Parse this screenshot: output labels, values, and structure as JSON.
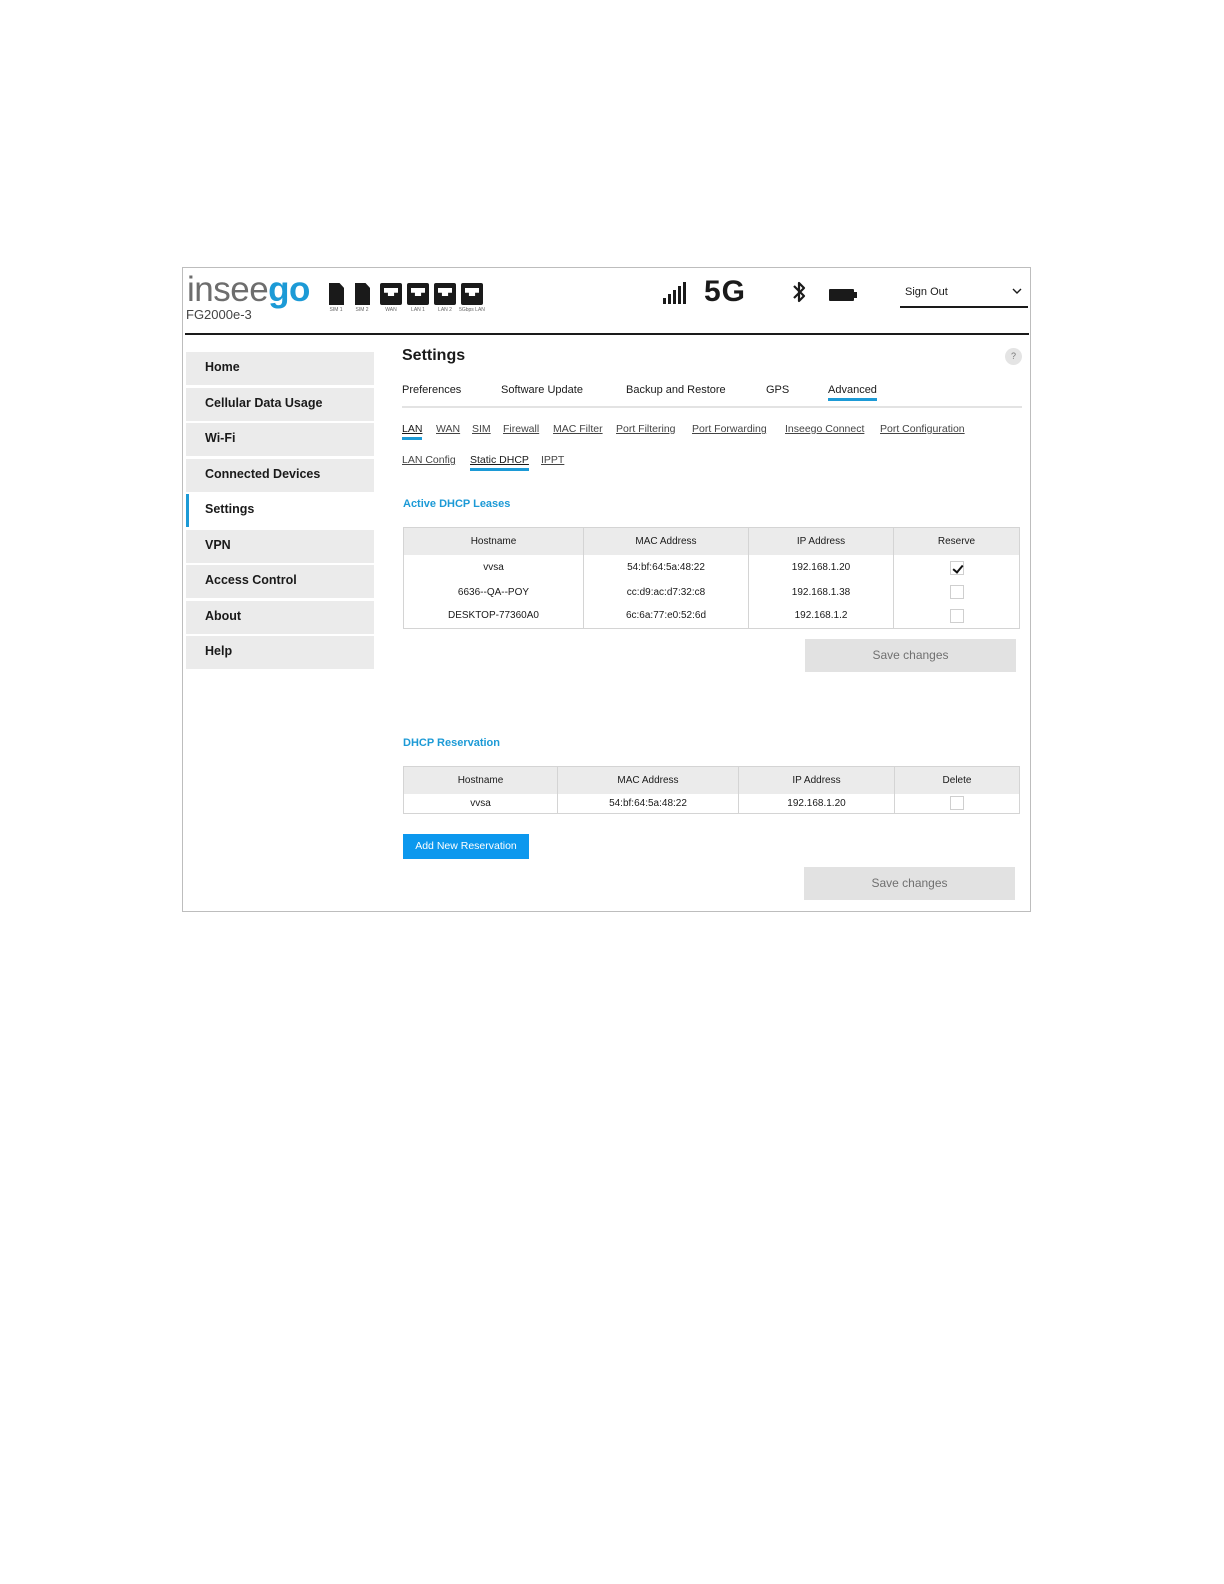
{
  "header": {
    "brand_part1": "insee",
    "brand_part2": "go",
    "model": "FG2000e-3",
    "ports": [
      {
        "icon": "sim-card-icon",
        "label": "SIM 1"
      },
      {
        "icon": "sim-card-icon",
        "label": "SIM 2"
      },
      {
        "icon": "ethernet-port-icon",
        "label": "WAN"
      },
      {
        "icon": "ethernet-port-icon",
        "label": "LAN 1"
      },
      {
        "icon": "ethernet-port-icon",
        "label": "LAN 2"
      },
      {
        "icon": "ethernet-port-icon",
        "label": "5Gbps LAN"
      }
    ],
    "network_type": "5G",
    "status_icons": [
      "signal-bars-icon",
      "bluetooth-icon",
      "battery-icon"
    ],
    "account_menu": {
      "selected": "Sign Out"
    }
  },
  "sidebar": {
    "items": [
      {
        "label": "Home"
      },
      {
        "label": "Cellular Data Usage"
      },
      {
        "label": "Wi-Fi"
      },
      {
        "label": "Connected Devices"
      },
      {
        "label": "Settings",
        "active": true
      },
      {
        "label": "VPN"
      },
      {
        "label": "Access Control"
      },
      {
        "label": "About"
      },
      {
        "label": "Help"
      }
    ]
  },
  "main": {
    "title": "Settings",
    "help_glyph": "?",
    "tabs": [
      "Preferences",
      "Software Update",
      "Backup and Restore",
      "GPS",
      "Advanced"
    ],
    "active_tab": "Advanced",
    "sublinks_row1": [
      "LAN",
      "WAN",
      "SIM",
      "Firewall",
      "MAC Filter",
      "Port Filtering",
      "Port Forwarding",
      "Inseego Connect",
      "Port Configuration"
    ],
    "sublinks_row2": [
      "LAN Config",
      "Static DHCP",
      "IPPT"
    ],
    "active_sublink": "Static DHCP"
  },
  "leases": {
    "title": "Active DHCP Leases",
    "headers": [
      "Hostname",
      "MAC Address",
      "IP Address",
      "Reserve"
    ],
    "rows": [
      {
        "hostname": "vvsa",
        "mac": "54:bf:64:5a:48:22",
        "ip": "192.168.1.20",
        "reserved": true
      },
      {
        "hostname": "6636--QA--POY",
        "mac": "cc:d9:ac:d7:32:c8",
        "ip": "192.168.1.38",
        "reserved": false
      },
      {
        "hostname": "DESKTOP-77360A0",
        "mac": "6c:6a:77:e0:52:6d",
        "ip": "192.168.1.2",
        "reserved": false
      }
    ],
    "save_label": "Save changes"
  },
  "reservation": {
    "title": "DHCP Reservation",
    "headers": [
      "Hostname",
      "MAC Address",
      "IP Address",
      "Delete"
    ],
    "rows": [
      {
        "hostname": "vvsa",
        "mac": "54:bf:64:5a:48:22",
        "ip": "192.168.1.20",
        "delete": false
      }
    ],
    "add_label": "Add New Reservation",
    "save_label": "Save changes"
  },
  "colors": {
    "accent": "#1c9ad6",
    "button_primary": "#0c98ee",
    "button_disabled": "#e2e2e2",
    "nav_bg": "#ebebeb"
  }
}
